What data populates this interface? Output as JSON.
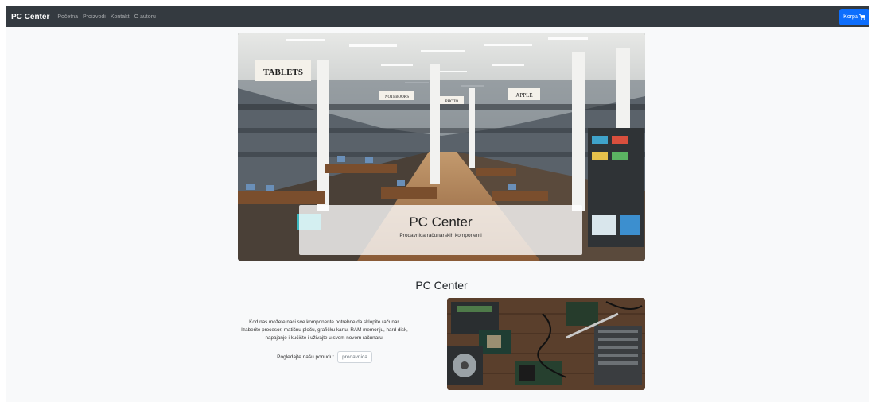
{
  "navbar": {
    "brand": "PC Center",
    "links": [
      "Početna",
      "Proizvodi",
      "Kontakt",
      "O autoru"
    ],
    "cart_label": "Korpa"
  },
  "hero": {
    "title": "PC Center",
    "subtitle": "Prodavnica računarskih komponenti",
    "signs": [
      "TABLETS",
      "NOTEBOOKS",
      "PHOTO",
      "APPLE"
    ]
  },
  "intro": {
    "title": "PC Center",
    "text_lines": [
      "Kod nas možete naći sve komponente potrebne da sklopite računar.",
      "Izaberite procesor, matičnu ploču, grafičku kartu, RAM memoriju, hard disk,",
      "napajanje i kućište i uživajte u svom novom računaru."
    ],
    "offer_label": "Pogledajte našu ponudu:",
    "offer_button": "prodavnica"
  },
  "colors": {
    "navbar_bg": "#343a40",
    "primary": "#0d6efd",
    "page_bg": "#f8f9fa"
  },
  "icons": {
    "cart": "cart-icon"
  }
}
